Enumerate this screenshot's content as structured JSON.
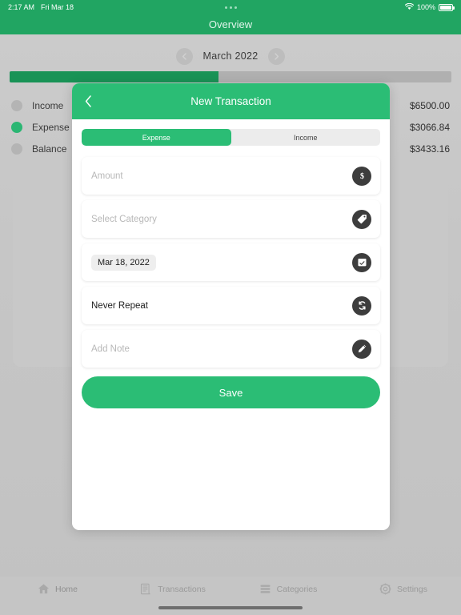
{
  "status_bar": {
    "time": "2:17 AM",
    "date": "Fri Mar 18",
    "battery_percent": "100%",
    "wifi_icon": "wifi-icon",
    "battery_icon": "battery-full-icon",
    "multitask_icon": "three-dots-icon"
  },
  "nav": {
    "title": "Overview"
  },
  "month_selector": {
    "prev_icon": "arrow-left-icon",
    "next_icon": "arrow-right-icon",
    "month": "March",
    "year": "2022",
    "label": "March  2022"
  },
  "progress": {
    "percent": 47.3,
    "fill_color": "#199356",
    "track_color": "#b0b0b0"
  },
  "summary": {
    "rows": [
      {
        "label": "Income",
        "value": "$6500.00",
        "dot_color": "#b4b4b4",
        "selected": false
      },
      {
        "label": "Expense",
        "value": "$3066.84",
        "dot_color": "#2bb673",
        "selected": true
      },
      {
        "label": "Balance",
        "value": "$3433.16",
        "dot_color": "#b4b4b4",
        "selected": false
      }
    ]
  },
  "modal": {
    "title": "New Transaction",
    "back_icon": "chevron-left-icon",
    "segments": [
      {
        "label": "Expense",
        "active": true
      },
      {
        "label": "Income",
        "active": false
      }
    ],
    "fields": {
      "amount": {
        "placeholder": "Amount",
        "value": "",
        "icon": "dollar-icon"
      },
      "category": {
        "placeholder": "Select Category",
        "value": "",
        "icon": "tag-icon"
      },
      "date": {
        "placeholder": "",
        "value": "Mar 18, 2022",
        "icon": "calendar-icon"
      },
      "repeat": {
        "placeholder": "",
        "value": "Never Repeat",
        "icon": "repeat-icon"
      },
      "note": {
        "placeholder": "Add Note",
        "value": "",
        "icon": "pencil-icon"
      }
    },
    "save_label": "Save"
  },
  "tabbar": {
    "items": [
      {
        "label": "Home",
        "icon": "home-icon",
        "active": true
      },
      {
        "label": "Transactions",
        "icon": "document-icon",
        "active": false
      },
      {
        "label": "Categories",
        "icon": "list-bars-icon",
        "active": false
      },
      {
        "label": "Settings",
        "icon": "gear-icon",
        "active": false
      }
    ]
  },
  "theme": {
    "accent": "#2bbd75",
    "status_green": "#21a562",
    "icon_badge": "#3d3d3d"
  }
}
